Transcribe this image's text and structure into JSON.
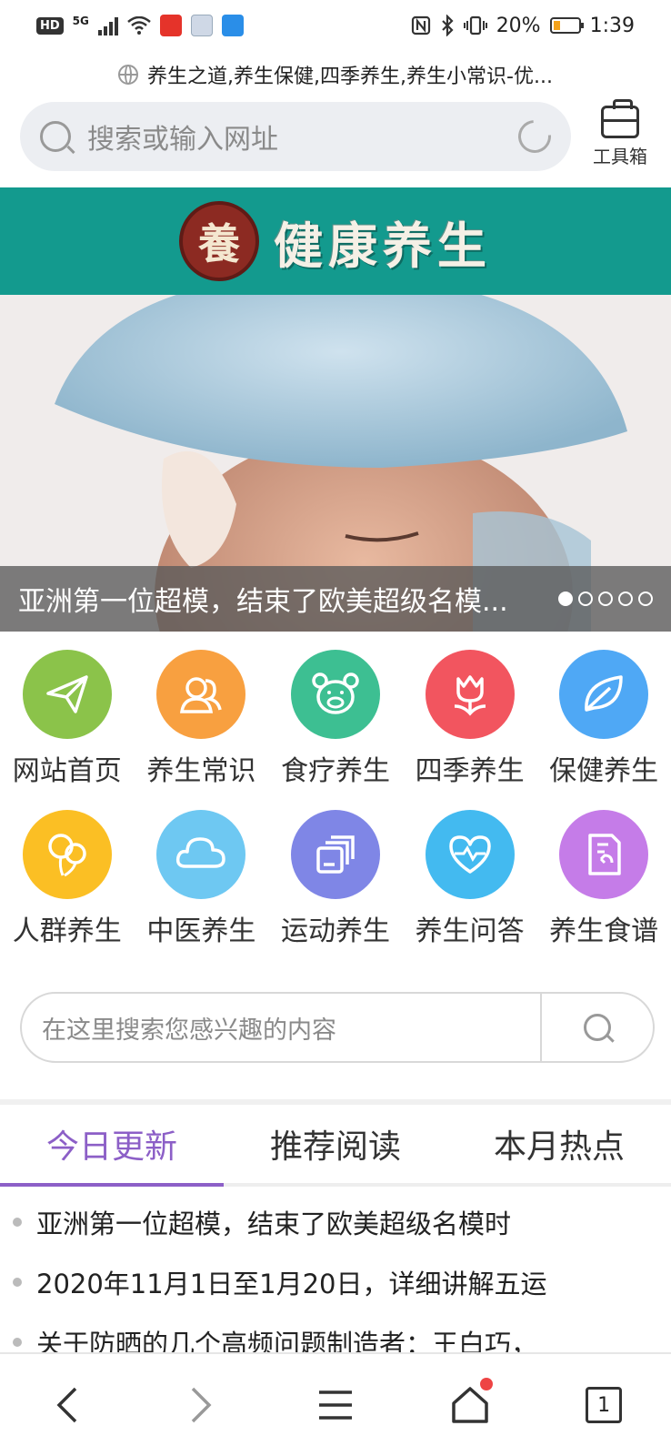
{
  "status_bar": {
    "hd": "HD",
    "network": "5G",
    "battery": "20%",
    "time": "1:39"
  },
  "page_title": "养生之道,养生保健,四季养生,养生小常识-优...",
  "address_bar": {
    "placeholder": "搜索或输入网址"
  },
  "toolbox": {
    "label": "工具箱"
  },
  "banner": {
    "logo_char": "養",
    "title": "健康养生",
    "color": "#139a8e"
  },
  "hero": {
    "caption": "亚洲第一位超模，结束了欧美超级名模...",
    "slide_count": 5,
    "active_slide": 1
  },
  "grid": {
    "rows": [
      [
        {
          "label": "网站首页",
          "icon": "paper-plane-icon",
          "color": "#8bc34a"
        },
        {
          "label": "养生常识",
          "icon": "users-icon",
          "color": "#f8a040"
        },
        {
          "label": "食疗养生",
          "icon": "pig-icon",
          "color": "#3dbf92"
        },
        {
          "label": "四季养生",
          "icon": "tulip-icon",
          "color": "#f2555f"
        },
        {
          "label": "保健养生",
          "icon": "leaf-icon",
          "color": "#4fa8f5"
        }
      ],
      [
        {
          "label": "人群养生",
          "icon": "balloons-icon",
          "color": "#fbbf24"
        },
        {
          "label": "中医养生",
          "icon": "cloud-icon",
          "color": "#6ec8f2"
        },
        {
          "label": "运动养生",
          "icon": "layers-icon",
          "color": "#7f86e6"
        },
        {
          "label": "养生问答",
          "icon": "heartbeat-icon",
          "color": "#43baf0"
        },
        {
          "label": "养生食谱",
          "icon": "document-icon",
          "color": "#c57ce8"
        }
      ]
    ]
  },
  "site_search": {
    "placeholder": "在这里搜索您感兴趣的内容"
  },
  "tabs": [
    "今日更新",
    "推荐阅读",
    "本月热点"
  ],
  "active_tab": 0,
  "accent_color": "#8c5fc7",
  "articles": [
    "亚洲第一位超模，结束了欧美超级名模时",
    "2020年11月1日至1月20日，详细讲解五运",
    "关于防晒的几个高频问题制造者：王白巧，"
  ],
  "bottom_nav": {
    "tab_count": "1"
  }
}
